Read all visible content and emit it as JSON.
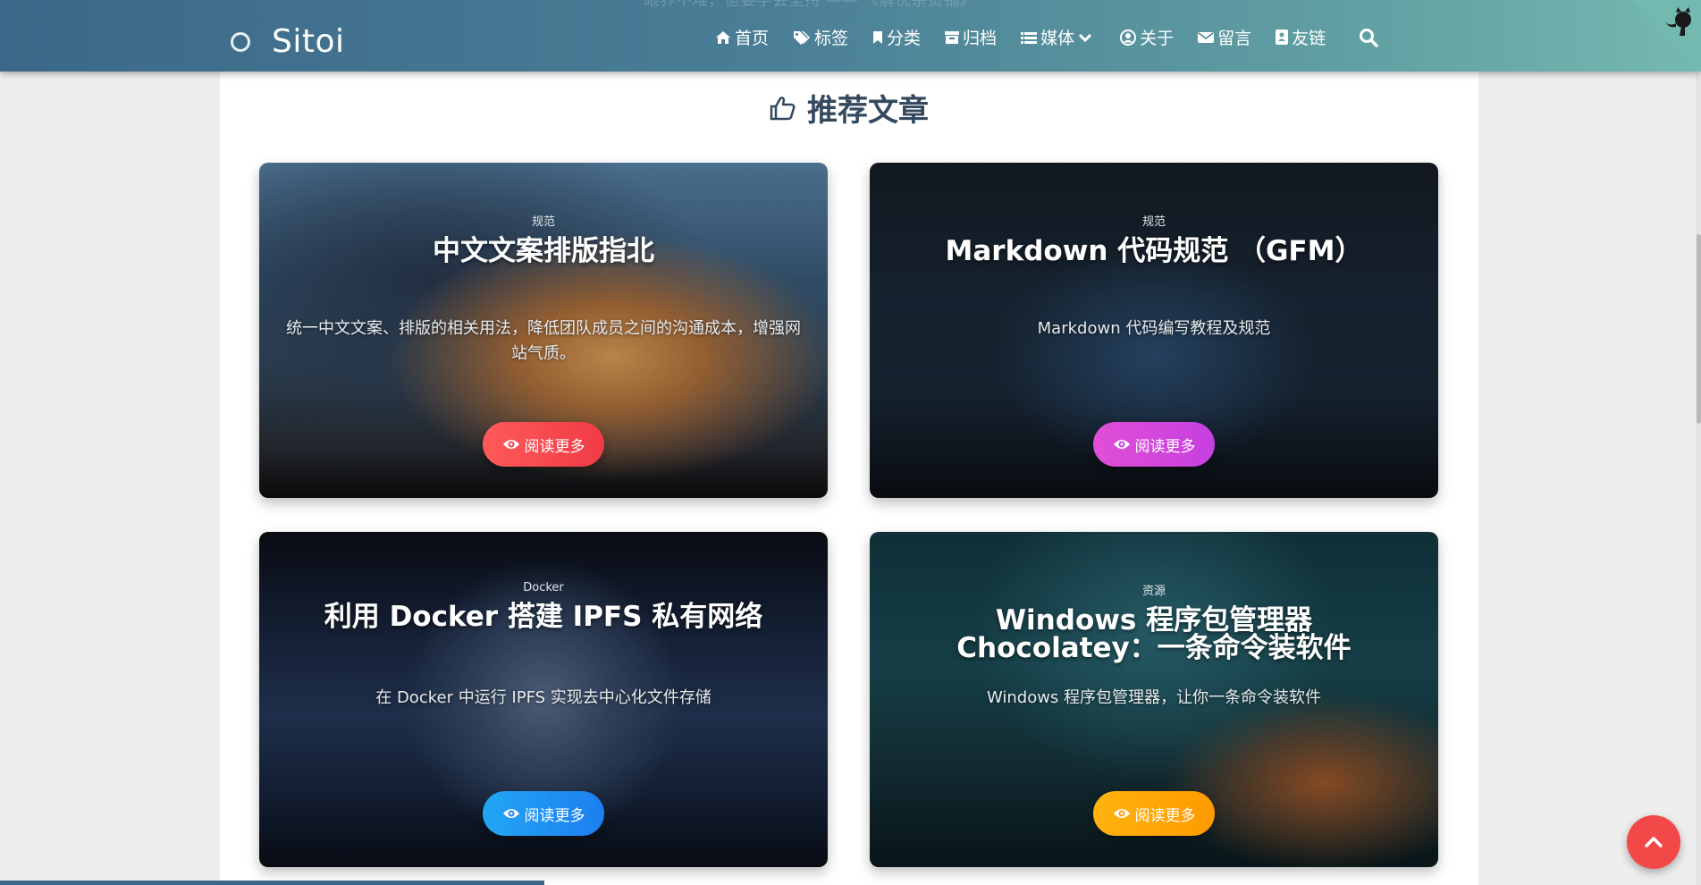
{
  "header": {
    "brand": "Sitoi",
    "bg_quote": "眼界不难，但要学会坚持 —— 《解忧杂货铺》",
    "nav": [
      {
        "label": "首页",
        "icon": "home-icon"
      },
      {
        "label": "标签",
        "icon": "tags-icon"
      },
      {
        "label": "分类",
        "icon": "bookmark-icon"
      },
      {
        "label": "归档",
        "icon": "archive-icon"
      },
      {
        "label": "媒体",
        "icon": "list-icon",
        "dropdown": true
      },
      {
        "label": "关于",
        "icon": "user-circle-icon"
      },
      {
        "label": "留言",
        "icon": "envelope-icon"
      },
      {
        "label": "友链",
        "icon": "address-book-icon"
      }
    ],
    "search_icon": "search-icon",
    "github_icon": "github-corner-icon"
  },
  "section": {
    "title": "推荐文章",
    "icon": "thumbs-up-icon"
  },
  "cards": [
    {
      "category": "规范",
      "title": "中文文案排版指北",
      "desc": "统一中文文案、排版的相关用法，降低团队成员之间的沟通成本，增强网站气质。",
      "button": "阅读更多",
      "button_color": "#f03b45"
    },
    {
      "category": "规范",
      "title": "Markdown 代码规范 （GFM）",
      "desc": "Markdown 代码编写教程及规范",
      "button": "阅读更多",
      "button_color": "#c63fe0"
    },
    {
      "category": "Docker",
      "title": "利用 Docker 搭建 IPFS 私有网络",
      "desc": "在 Docker 中运行 IPFS 实现去中心化文件存储",
      "button": "阅读更多",
      "button_color": "#1c7ff0"
    },
    {
      "category": "资源",
      "title": "Windows 程序包管理器 Chocolatey：一条命令装软件",
      "desc": "Windows 程序包管理器，让你一条命令装软件",
      "button": "阅读更多",
      "button_color": "#ff9a00"
    }
  ],
  "back_to_top_icon": "chevron-up-icon",
  "reading_progress": 0.32,
  "colors": {
    "header_start": "#3b6888",
    "header_end": "#74b9b0",
    "title_text": "#34495e",
    "back_to_top": "#f24848"
  }
}
